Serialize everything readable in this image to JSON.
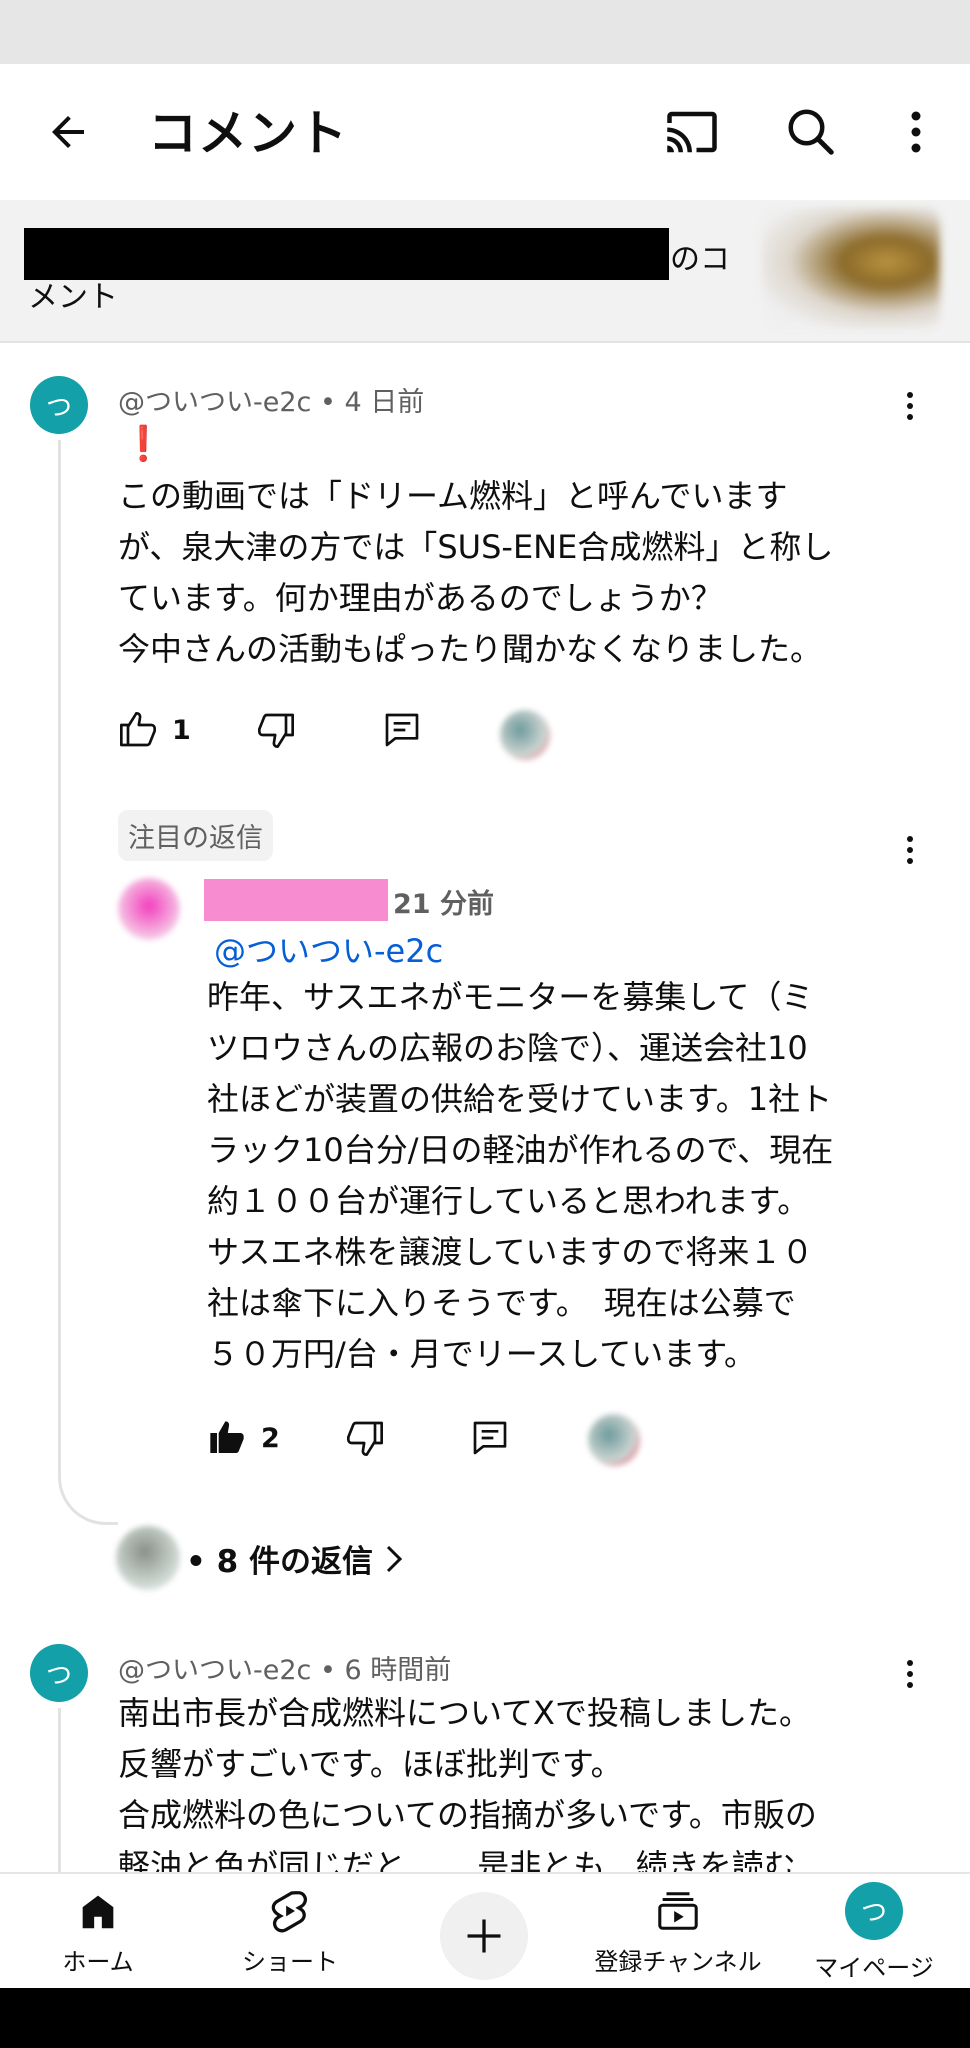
{
  "app_bar": {
    "title": "コメント",
    "icons": [
      "back-arrow-icon",
      "cast-icon",
      "search-icon",
      "more-vert-icon"
    ]
  },
  "video_header": {
    "title_suffix_line1": "のコ",
    "title_suffix_line2": "メント"
  },
  "comments": [
    {
      "author": "@ついつい-e2c",
      "time": "4 日前",
      "avatar_letter": "つ",
      "emoji": "❗",
      "text": "この動画では「ドリーム燃料」と呼んでいます\nが、泉大津の方では「SUS-ENE合成燃料」と称し\nています。何か理由があるのでしょうか？\n今中さんの活動もぱったり聞かなくなりました。",
      "likes": "1",
      "pinned_reply_label": "注目の返信",
      "reply": {
        "time": "21 分前",
        "mention": "@ついつい-e2c",
        "text": "昨年、サスエネがモニターを募集して（ミ\nツロウさんの広報のお陰で）、運送会社10\n社ほどが装置の供給を受けています。1社ト\nラック10台分/日の軽油が作れるので、現在\n約１００台が運行していると思われます。\nサスエネ株を譲渡していますので将来１０\n社は傘下に入りそうです。　現在は公募で\n５０万円/台・月でリースしています。",
        "likes": "2"
      },
      "more_replies": "• 8 件の返信"
    },
    {
      "author": "@ついつい-e2c",
      "time": "6 時間前",
      "avatar_letter": "つ",
      "text": "南出市長が合成燃料についてXで投稿しました。\n反響がすごいです。ほぼ批判です。\n合成燃料の色についての指摘が多いです。市販の\n軽油と色が同じだと...    是非とも   続きを読む"
    }
  ],
  "bottom_nav": {
    "items": [
      {
        "label": "ホーム",
        "icon": "home-icon"
      },
      {
        "label": "ショート",
        "icon": "shorts-icon"
      },
      {
        "label": "",
        "icon": "add-icon"
      },
      {
        "label": "登録チャンネル",
        "icon": "subscriptions-icon"
      },
      {
        "label": "マイページ",
        "icon": "avatar-icon",
        "avatar_letter": "つ"
      }
    ]
  },
  "colors": {
    "avatar_teal": "#13a0a8",
    "mention_blue": "#065fd4",
    "redaction_pink": "#f78dd0"
  }
}
